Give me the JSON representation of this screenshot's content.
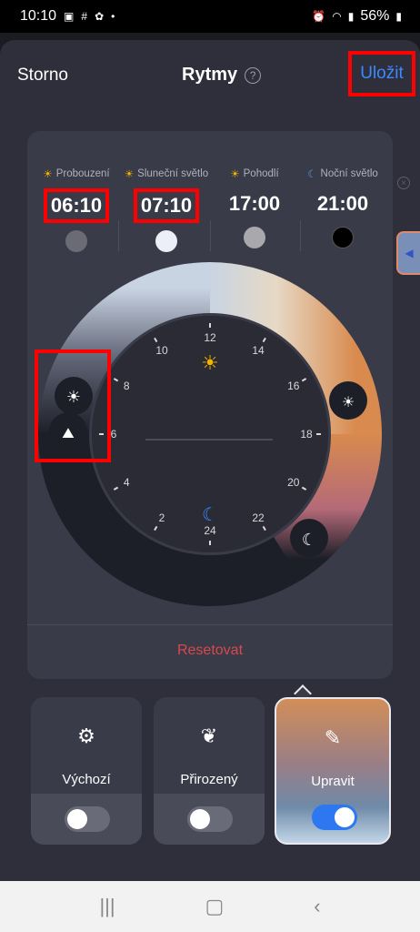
{
  "statusbar": {
    "time": "10:10",
    "battery": "56%"
  },
  "header": {
    "cancel_label": "Storno",
    "title": "Rytmy",
    "help": "?",
    "save_label": "Uložit"
  },
  "times": [
    {
      "label": "Probouzení",
      "value": "06:10",
      "dot_color": "#6a6b75",
      "icon": "sunrise-icon"
    },
    {
      "label": "Sluneční světlo",
      "value": "07:10",
      "dot_color": "#eceef8",
      "icon": "sun-icon"
    },
    {
      "label": "Pohodlí",
      "value": "17:00",
      "dot_color": "#a9a9ad",
      "icon": "sun-cloud-icon"
    },
    {
      "label": "Noční světlo",
      "value": "21:00",
      "dot_color": "#000000",
      "icon": "moon-icon"
    }
  ],
  "dial": {
    "hours": [
      "12",
      "14",
      "16",
      "18",
      "20",
      "22",
      "24",
      "2",
      "4",
      "6",
      "8",
      "10"
    ]
  },
  "reset_label": "Resetovat",
  "modes": [
    {
      "label": "Výchozí",
      "icon": "gear-icon",
      "on": false
    },
    {
      "label": "Přirozený",
      "icon": "leaf-icon",
      "on": false
    },
    {
      "label": "Upravit",
      "icon": "pencil-icon",
      "on": true
    }
  ],
  "colors": {
    "save": "#3a8bff",
    "reset": "#d9484c",
    "toggle_on": "#2d78f0",
    "highlight": "#ff0000"
  }
}
